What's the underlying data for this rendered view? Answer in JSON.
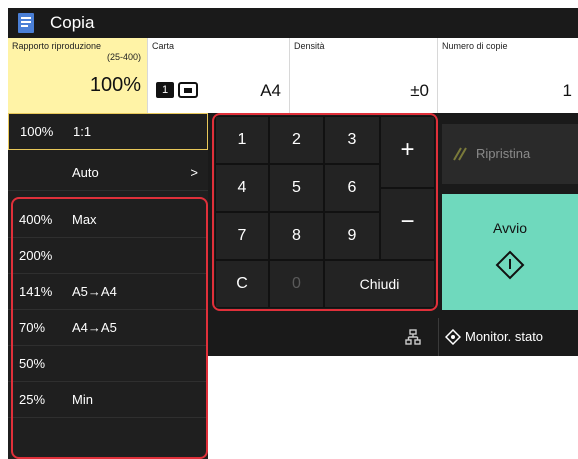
{
  "title": "Copia",
  "settings": {
    "ratio_label": "Rapporto riproduzione",
    "ratio_range": "(25-400)",
    "ratio_value": "100%",
    "paper_label": "Carta",
    "paper_value": "A4",
    "paper_tray": "1",
    "density_label": "Densità",
    "density_value": "±0",
    "copies_label": "Numero di copie",
    "copies_value": "1"
  },
  "left_items": [
    {
      "pct": "100%",
      "name": "1:1"
    },
    {
      "pct": "",
      "name": "Auto",
      "arrow": ">"
    },
    {
      "pct": "400%",
      "name": "Max"
    },
    {
      "pct": "200%",
      "name": ""
    },
    {
      "pct": "141%",
      "name": "A5→A4"
    },
    {
      "pct": "70%",
      "name": "A4→A5"
    },
    {
      "pct": "50%",
      "name": ""
    },
    {
      "pct": "25%",
      "name": "Min"
    }
  ],
  "keypad": {
    "keys": [
      "1",
      "2",
      "3",
      "4",
      "5",
      "6",
      "7",
      "8",
      "9"
    ],
    "plus": "+",
    "minus": "−",
    "clear": "C",
    "zero": "0",
    "close": "Chiudi"
  },
  "actions": {
    "reset": "Ripristina",
    "start": "Avvio",
    "monitor": "Monitor. stato"
  },
  "colors": {
    "selected_yellow": "#fff3a6",
    "start_green": "#6fd9bd",
    "highlight_red": "#e0303a"
  }
}
